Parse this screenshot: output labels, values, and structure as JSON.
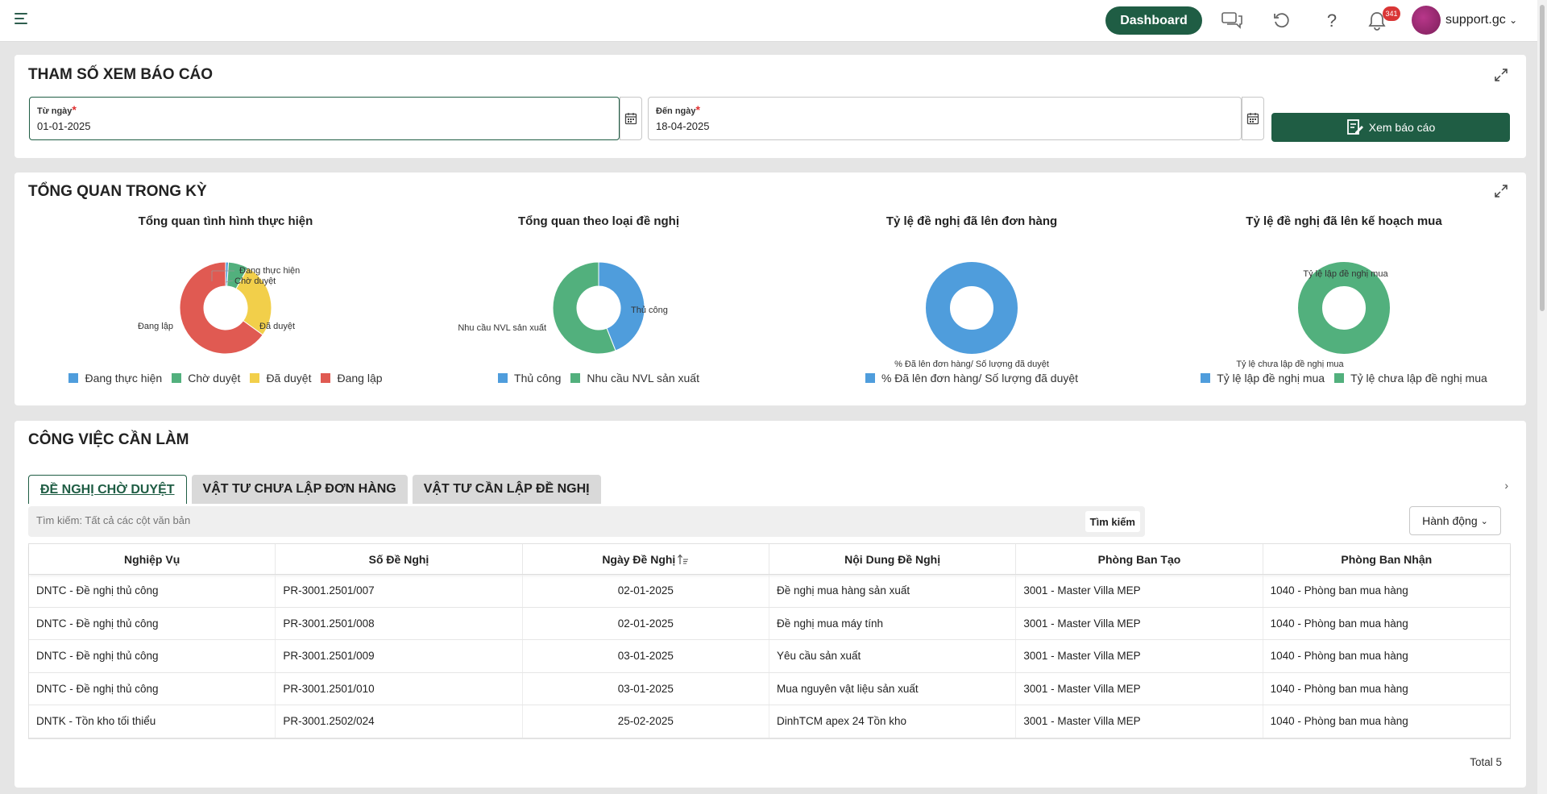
{
  "topbar": {
    "dashboard_label": "Dashboard",
    "notification_count": "341",
    "username": "support.gc",
    "help_glyph": "?"
  },
  "params": {
    "title": "THAM SỐ XEM BÁO CÁO",
    "from_label": "Từ ngày",
    "from_value": "01-01-2025",
    "to_label": "Đến ngày",
    "to_value": "18-04-2025",
    "required_mark": "*",
    "report_button": "Xem báo cáo"
  },
  "overview": {
    "title": "TỔNG QUAN TRONG KỲ",
    "charts": [
      {
        "title": "Tổng quan tình hình thực hiện",
        "legend": [
          "Đang thực hiện",
          "Chờ duyệt",
          "Đã duyệt",
          "Đang lập"
        ],
        "slice_labels": [
          "Đang thực hiện",
          "Chờ duyệt",
          "Đã duyệt",
          "Đang lập"
        ]
      },
      {
        "title": "Tổng quan theo loại đề nghị",
        "legend": [
          "Thủ công",
          "Nhu cầu NVL sản xuất"
        ],
        "slice_labels": [
          "Thủ công",
          "Nhu cầu NVL sản xuất"
        ]
      },
      {
        "title": "Tỷ lệ đề nghị đã lên đơn hàng",
        "legend": [
          "% Đã lên đơn hàng/ Số lượng đã duyệt"
        ],
        "slice_labels": [
          "% Đã lên đơn hàng/ Số lượng đã duyệt"
        ]
      },
      {
        "title": "Tỷ lệ đề nghị đã lên kế hoạch mua",
        "legend": [
          "Tỷ lệ lập đề nghị mua",
          "Tỷ lệ chưa lập đề nghị mua"
        ],
        "slice_labels": [
          "Tỷ lệ lập đề nghị mua",
          "Tỷ lệ chưa lập đề nghị mua"
        ]
      }
    ]
  },
  "chart_data": [
    {
      "type": "pie",
      "title": "Tổng quan tình hình thực hiện",
      "categories": [
        "Đang thực hiện",
        "Chờ duyệt",
        "Đã duyệt",
        "Đang lập"
      ],
      "values": [
        1,
        7,
        27,
        65
      ],
      "colors": [
        "#4f9ddc",
        "#52b07d",
        "#f2cf4a",
        "#e05a52"
      ]
    },
    {
      "type": "pie",
      "title": "Tổng quan theo loại đề nghị",
      "categories": [
        "Thủ công",
        "Nhu cầu NVL sản xuất"
      ],
      "values": [
        44,
        56
      ],
      "colors": [
        "#4f9ddc",
        "#52b07d"
      ]
    },
    {
      "type": "pie",
      "title": "Tỷ lệ đề nghị đã lên đơn hàng",
      "categories": [
        "% Đã lên đơn hàng/ Số lượng đã duyệt"
      ],
      "values": [
        100
      ],
      "colors": [
        "#4f9ddc"
      ]
    },
    {
      "type": "pie",
      "title": "Tỷ lệ đề nghị đã lên kế hoạch mua",
      "categories": [
        "Tỷ lệ lập đề nghị mua",
        "Tỷ lệ chưa lập đề nghị mua"
      ],
      "values": [
        0,
        100
      ],
      "colors": [
        "#4f9ddc",
        "#52b07d"
      ]
    }
  ],
  "tasks": {
    "title": "CÔNG VIỆC CẦN LÀM",
    "tabs": [
      "ĐỀ NGHỊ CHỜ DUYỆT",
      "VẬT TƯ CHƯA LẬP ĐƠN HÀNG",
      "VẬT TƯ CẦN LẬP ĐỀ NGHỊ"
    ],
    "search_placeholder": "Tìm kiếm: Tất cả các cột văn bản",
    "search_button": "Tìm kiếm",
    "action_button": "Hành động",
    "columns": [
      "Nghiệp Vụ",
      "Số Đề Nghị",
      "Ngày Đề Nghị",
      "Nội Dung Đề Nghị",
      "Phòng Ban Tạo",
      "Phòng Ban Nhận"
    ],
    "rows": [
      [
        "DNTC - Đề nghị thủ công",
        "PR-3001.2501/007",
        "02-01-2025",
        "Đề nghị mua hàng sản xuất",
        "3001 - Master Villa MEP",
        "1040 - Phòng ban mua hàng"
      ],
      [
        "DNTC - Đề nghị thủ công",
        "PR-3001.2501/008",
        "02-01-2025",
        "Đề nghị mua máy tính",
        "3001 - Master Villa MEP",
        "1040 - Phòng ban mua hàng"
      ],
      [
        "DNTC - Đề nghị thủ công",
        "PR-3001.2501/009",
        "03-01-2025",
        "Yêu cầu sản xuất",
        "3001 - Master Villa MEP",
        "1040 - Phòng ban mua hàng"
      ],
      [
        "DNTC - Đề nghị thủ công",
        "PR-3001.2501/010",
        "03-01-2025",
        "Mua nguyên vật liệu sản xuất",
        "3001 - Master Villa MEP",
        "1040 - Phòng ban mua hàng"
      ],
      [
        "DNTK - Tồn kho tối thiểu",
        "PR-3001.2502/024",
        "25-02-2025",
        "DinhTCM apex 24 Tồn kho",
        "3001 - Master Villa MEP",
        "1040 - Phòng ban mua hàng"
      ]
    ],
    "total": "Total 5"
  }
}
